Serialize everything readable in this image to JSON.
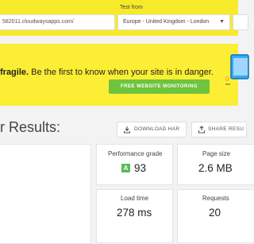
{
  "header": {
    "url_value": "582011.cloudwaysapps.com/",
    "test_from_label": "Test from",
    "location_value": "Europe - United Kingdom - London"
  },
  "banner": {
    "text_bold": "fragile.",
    "text_rest": " Be the first to know when your site is in danger.",
    "button_label": "FREE WEBSITE MONITORING"
  },
  "results": {
    "title": "r Results:",
    "download_label": "DOWNLOAD HAR",
    "share_label": "SHARE RESU"
  },
  "metrics": {
    "performance_grade": {
      "label": "Performance grade",
      "grade": "A",
      "value": "93"
    },
    "page_size": {
      "label": "Page size",
      "value": "2.6 MB"
    },
    "load_time": {
      "label": "Load time",
      "value": "278 ms"
    },
    "requests": {
      "label": "Requests",
      "value": "20"
    }
  },
  "colors": {
    "yellow": "#f7ea2b",
    "green": "#6fc33d",
    "grade_green": "#5cb85c",
    "illustration_blue": "#33aaff"
  },
  "icons": [
    "chevron-down-icon",
    "download-icon",
    "share-icon",
    "monitor-illustration"
  ]
}
